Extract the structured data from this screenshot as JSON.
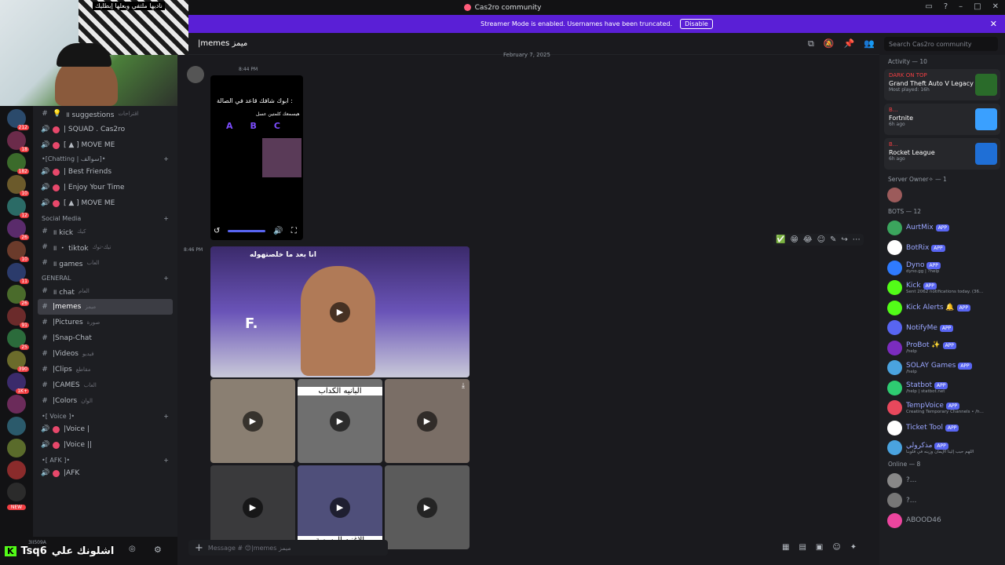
{
  "window": {
    "title": "Cas2ro community"
  },
  "banner": {
    "text": "Streamer Mode is enabled. Usernames have been truncated.",
    "button": "Disable"
  },
  "webcam": {
    "overlay_text": "ناديها ملتفي وبعلها إبطليك"
  },
  "server_badges": [
    "212",
    "18",
    "182",
    "10",
    "12",
    "26",
    "10",
    "11",
    "26",
    "91",
    "25",
    "390",
    "1K+"
  ],
  "server_new_label": "NEW",
  "channels": {
    "top": [
      {
        "icon": "bulb-icon",
        "name": "॥ suggestions",
        "sub": "اقتراحات",
        "kind": "text"
      },
      {
        "icon": "voice-icon",
        "name": "| SQUAD . Cas2ro",
        "kind": "voice"
      },
      {
        "icon": "voice-icon",
        "name": "[ ▲ ] MOVE ME",
        "kind": "voice"
      }
    ],
    "categories": [
      {
        "name": "•[Chatting | سوالف]•",
        "items": [
          {
            "name": "| Best Friends",
            "kind": "voice"
          },
          {
            "name": "| Enjoy Your Time",
            "kind": "voice"
          },
          {
            "name": "[ ▲ ] MOVE ME",
            "kind": "voice"
          }
        ]
      },
      {
        "name": "Social Media",
        "items": [
          {
            "name": "॥ kick",
            "sub": "كيك",
            "kind": "text"
          },
          {
            "name": "॥ ・ tiktok",
            "sub": "تيك-توك",
            "kind": "text"
          },
          {
            "name": "॥ games",
            "sub": "العاب",
            "kind": "text"
          }
        ]
      },
      {
        "name": "GENERAL",
        "items": [
          {
            "name": "॥ chat",
            "sub": "العام",
            "kind": "text"
          },
          {
            "name": "|memes",
            "sub": "ميمز",
            "kind": "text",
            "active": true
          },
          {
            "name": "|Pictures",
            "sub": "صورة",
            "kind": "text"
          },
          {
            "name": "|Snap-Chat",
            "kind": "text"
          },
          {
            "name": "|Videos",
            "sub": "فيديو",
            "kind": "text"
          },
          {
            "name": "|Clips",
            "sub": "مقاطع",
            "kind": "text"
          },
          {
            "name": "|CAMES",
            "sub": "العاب",
            "kind": "text"
          },
          {
            "name": "|Colors",
            "sub": "الوان",
            "kind": "text"
          }
        ]
      },
      {
        "name": "•[ Voice ]•",
        "items": [
          {
            "name": "|Voice |",
            "kind": "voice"
          },
          {
            "name": "|Voice ||",
            "kind": "voice"
          }
        ]
      },
      {
        "name": "•[ AFK ]•",
        "items": [
          {
            "name": "|AFK",
            "kind": "voice"
          }
        ]
      }
    ]
  },
  "userbar": {
    "platform": "K",
    "handle": "Tsq6",
    "arabic": "اشلونك علي",
    "tag": "3II509A"
  },
  "chat": {
    "channel_title": "|memes ميمز",
    "date": "February 7, 2025",
    "msg1_time": "8:44 PM",
    "msg2_time": "8:46 PM",
    "video1_text": "ابوك شافك قاعد في الصالة :",
    "video1_sub": "هيسمعك كلمتين عسل",
    "video1_options": [
      "A",
      "B",
      "C"
    ],
    "bigvideo_caption": "انا بعد ما خلصتهوله",
    "bigvideo_letter": "F.",
    "thumb_captions": [
      "البانيه الكداب",
      "الاغنيه الرسمية"
    ],
    "composer_placeholder": "Message # 😊|memes ميمز"
  },
  "search": {
    "placeholder": "Search Cas2ro community"
  },
  "members": {
    "activity_header": "Activity — 10",
    "activities": [
      {
        "label": "DARK ON TOP",
        "game": "Grand Theft Auto V Legacy",
        "meta": "Most played: 16h",
        "color": "#2a6b2a"
      },
      {
        "label": "B...",
        "game": "Fortnite",
        "meta": "6h ago",
        "color": "#3aa0ff"
      },
      {
        "label": "B...",
        "game": "Rocket League",
        "meta": "6h ago",
        "color": "#1f6fd6"
      }
    ],
    "owner_header": "Server Owner✧ — 1",
    "bots_header": "BOTS — 12",
    "bots": [
      {
        "name": "AurtMix",
        "status": "",
        "color": "#3ba55d"
      },
      {
        "name": "BotRix",
        "status": "",
        "color": "#ffffff"
      },
      {
        "name": "Dyno",
        "status": "dyno.gg | ?help",
        "color": "#2f7bff"
      },
      {
        "name": "Kick",
        "status": "Sent 2062 notifications today. (36...",
        "color": "#53fc18"
      },
      {
        "name": "Kick Alerts 🔔",
        "status": "",
        "color": "#53fc18"
      },
      {
        "name": "NotifyMe",
        "status": "",
        "color": "#5865f2"
      },
      {
        "name": "ProBot ✨",
        "status": "/help",
        "color": "#7b2cbf"
      },
      {
        "name": "SOLAY Games",
        "status": "/help",
        "color": "#4aa3df"
      },
      {
        "name": "Statbot",
        "status": "/help | statbot.net",
        "color": "#2ecc71"
      },
      {
        "name": "TempVoice",
        "status": "Creating Temporary Channels • /h...",
        "color": "#e8485c"
      },
      {
        "name": "Ticket Tool",
        "status": "",
        "color": "#ffffff"
      },
      {
        "name": "مذكرولي",
        "status": "اللهم حبب إلينا الإيمان وزينه في قلوبنا",
        "color": "#4aa3df"
      }
    ],
    "online_header": "Online — 8",
    "online": [
      {
        "name": "?...",
        "color": "#888888"
      },
      {
        "name": "?...",
        "color": "#777777"
      },
      {
        "name": "ABOOD46",
        "color": "#eb459e"
      }
    ],
    "app_label": "APP"
  }
}
